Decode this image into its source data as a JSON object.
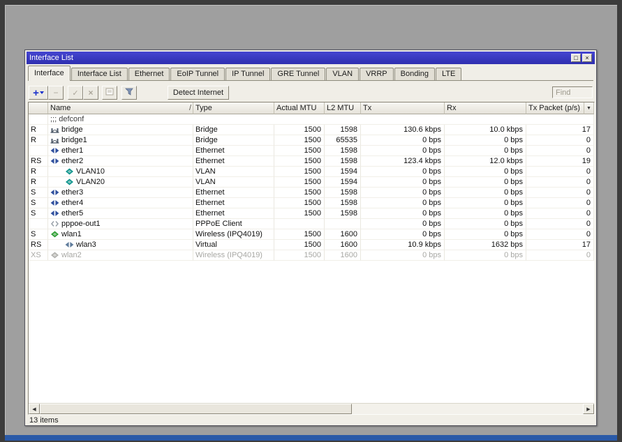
{
  "colors": {
    "titlebar_start": "#4545d1",
    "titlebar_end": "#2f2fb0",
    "taskbar_blue": "#2a5aa8",
    "add_accent": "#1c32cc"
  },
  "window": {
    "title": "Interface List",
    "maximize_glyph": "□",
    "close_glyph": "×"
  },
  "tabs": [
    {
      "label": "Interface",
      "active": true
    },
    {
      "label": "Interface List"
    },
    {
      "label": "Ethernet"
    },
    {
      "label": "EoIP Tunnel"
    },
    {
      "label": "IP Tunnel"
    },
    {
      "label": "GRE Tunnel"
    },
    {
      "label": "VLAN"
    },
    {
      "label": "VRRP"
    },
    {
      "label": "Bonding"
    },
    {
      "label": "LTE"
    }
  ],
  "toolbar": {
    "add_label": "+",
    "remove_label": "−",
    "enable_label": "✓",
    "disable_label": "×",
    "detect_internet_label": "Detect Internet",
    "find_placeholder": "Find"
  },
  "table": {
    "column_select_glyph": "▼",
    "comment_row": ";;; defconf",
    "columns": [
      {
        "key": "name",
        "label": "Name",
        "sort_indicator": "/"
      },
      {
        "key": "type",
        "label": "Type"
      },
      {
        "key": "actual_mtu",
        "label": "Actual MTU"
      },
      {
        "key": "l2_mtu",
        "label": "L2 MTU"
      },
      {
        "key": "tx",
        "label": "Tx"
      },
      {
        "key": "rx",
        "label": "Rx"
      },
      {
        "key": "tx_packet",
        "label": "Tx Packet (p/s)"
      }
    ],
    "rows": [
      {
        "flags": "R",
        "icon": "bridge",
        "indent": 0,
        "name": "bridge",
        "type": "Bridge",
        "actual_mtu": "1500",
        "l2_mtu": "1598",
        "tx": "130.6 kbps",
        "rx": "10.0 kbps",
        "tx_packet": "17",
        "disabled": false
      },
      {
        "flags": "R",
        "icon": "bridge",
        "indent": 0,
        "name": "bridge1",
        "type": "Bridge",
        "actual_mtu": "1500",
        "l2_mtu": "65535",
        "tx": "0 bps",
        "rx": "0 bps",
        "tx_packet": "0",
        "disabled": false
      },
      {
        "flags": "",
        "icon": "ethernet",
        "indent": 0,
        "name": "ether1",
        "type": "Ethernet",
        "actual_mtu": "1500",
        "l2_mtu": "1598",
        "tx": "0 bps",
        "rx": "0 bps",
        "tx_packet": "0",
        "disabled": false
      },
      {
        "flags": "RS",
        "icon": "ethernet",
        "indent": 0,
        "name": "ether2",
        "type": "Ethernet",
        "actual_mtu": "1500",
        "l2_mtu": "1598",
        "tx": "123.4 kbps",
        "rx": "12.0 kbps",
        "tx_packet": "19",
        "disabled": false
      },
      {
        "flags": "R",
        "icon": "vlan",
        "indent": 1,
        "name": "VLAN10",
        "type": "VLAN",
        "actual_mtu": "1500",
        "l2_mtu": "1594",
        "tx": "0 bps",
        "rx": "0 bps",
        "tx_packet": "0",
        "disabled": false
      },
      {
        "flags": "R",
        "icon": "vlan",
        "indent": 1,
        "name": "VLAN20",
        "type": "VLAN",
        "actual_mtu": "1500",
        "l2_mtu": "1594",
        "tx": "0 bps",
        "rx": "0 bps",
        "tx_packet": "0",
        "disabled": false
      },
      {
        "flags": "S",
        "icon": "ethernet",
        "indent": 0,
        "name": "ether3",
        "type": "Ethernet",
        "actual_mtu": "1500",
        "l2_mtu": "1598",
        "tx": "0 bps",
        "rx": "0 bps",
        "tx_packet": "0",
        "disabled": false
      },
      {
        "flags": "S",
        "icon": "ethernet",
        "indent": 0,
        "name": "ether4",
        "type": "Ethernet",
        "actual_mtu": "1500",
        "l2_mtu": "1598",
        "tx": "0 bps",
        "rx": "0 bps",
        "tx_packet": "0",
        "disabled": false
      },
      {
        "flags": "S",
        "icon": "ethernet",
        "indent": 0,
        "name": "ether5",
        "type": "Ethernet",
        "actual_mtu": "1500",
        "l2_mtu": "1598",
        "tx": "0 bps",
        "rx": "0 bps",
        "tx_packet": "0",
        "disabled": false
      },
      {
        "flags": "",
        "icon": "pppoe",
        "indent": 0,
        "name": "pppoe-out1",
        "type": "PPPoE Client",
        "actual_mtu": "",
        "l2_mtu": "",
        "tx": "0 bps",
        "rx": "0 bps",
        "tx_packet": "0",
        "disabled": false
      },
      {
        "flags": "S",
        "icon": "wireless",
        "indent": 0,
        "name": "wlan1",
        "type": "Wireless (IPQ4019)",
        "actual_mtu": "1500",
        "l2_mtu": "1600",
        "tx": "0 bps",
        "rx": "0 bps",
        "tx_packet": "0",
        "disabled": false
      },
      {
        "flags": "RS",
        "icon": "virtual",
        "indent": 1,
        "name": "wlan3",
        "type": "Virtual",
        "actual_mtu": "1500",
        "l2_mtu": "1600",
        "tx": "10.9 kbps",
        "rx": "1632 bps",
        "tx_packet": "17",
        "disabled": false
      },
      {
        "flags": "XS",
        "icon": "wireless",
        "indent": 0,
        "name": "wlan2",
        "type": "Wireless (IPQ4019)",
        "actual_mtu": "1500",
        "l2_mtu": "1600",
        "tx": "0 bps",
        "rx": "0 bps",
        "tx_packet": "0",
        "disabled": true
      }
    ]
  },
  "scrollbar": {
    "left_glyph": "◀",
    "right_glyph": "▶"
  },
  "statusbar": {
    "text": "13 items"
  }
}
